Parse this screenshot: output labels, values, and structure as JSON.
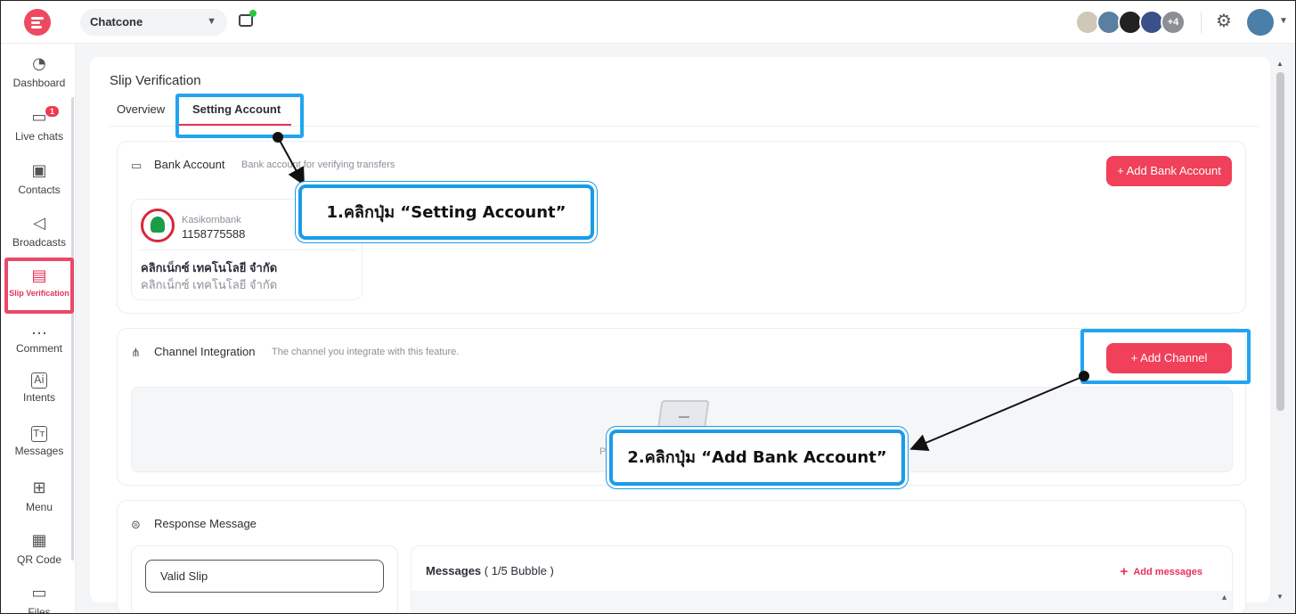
{
  "topbar": {
    "workspace": "Chatcone",
    "avatars_more": "+4",
    "colors": {
      "accent": "#f0405a",
      "highlight": "#22a4f0"
    }
  },
  "sidebar": {
    "items": [
      {
        "label": "Dashboard",
        "icon": "pie-chart-icon"
      },
      {
        "label": "Live chats",
        "icon": "chat-bubbles-icon",
        "badge": "1"
      },
      {
        "label": "Contacts",
        "icon": "contact-book-icon"
      },
      {
        "label": "Broadcasts",
        "icon": "megaphone-icon"
      },
      {
        "label": "Slip Verification",
        "icon": "clipboard-shield-icon",
        "active": true
      },
      {
        "label": "Comment",
        "icon": "comment-icon"
      },
      {
        "label": "Intents",
        "icon": "ai-icon"
      },
      {
        "label": "Messages",
        "icon": "text-message-icon"
      },
      {
        "label": "Menu",
        "icon": "grid-icon"
      },
      {
        "label": "QR Code",
        "icon": "qr-code-icon"
      },
      {
        "label": "Files",
        "icon": "folder-icon"
      }
    ]
  },
  "page": {
    "title": "Slip Verification",
    "tabs": [
      {
        "label": "Overview"
      },
      {
        "label": "Setting Account",
        "active": true
      }
    ]
  },
  "bank_account": {
    "title": "Bank Account",
    "subtitle": "Bank account for verifying transfers",
    "add_button": "+ Add Bank Account",
    "card": {
      "bank_name": "Kasikornbank",
      "account_no": "1158775588",
      "account_name": "คลิกเน็กซ์ เทคโนโลยี จำกัด",
      "account_name_sub": "คลิกเน็กซ์ เทคโนโลยี จำกัด"
    }
  },
  "channel_integration": {
    "title": "Channel Integration",
    "subtitle": "The channel you integrate with this feature.",
    "add_button": "+ Add Channel",
    "empty_text": "Pl"
  },
  "response_message": {
    "title": "Response Message",
    "valid_slip": "Valid Slip",
    "messages_label": "Messages",
    "messages_count": " ( 1/5 Bubble )",
    "add_messages": "Add messages"
  },
  "annotations": {
    "step1": "1.คลิกปุ่ม “Setting Account”",
    "step2": "2.คลิกปุ่ม “Add Bank Account”"
  }
}
